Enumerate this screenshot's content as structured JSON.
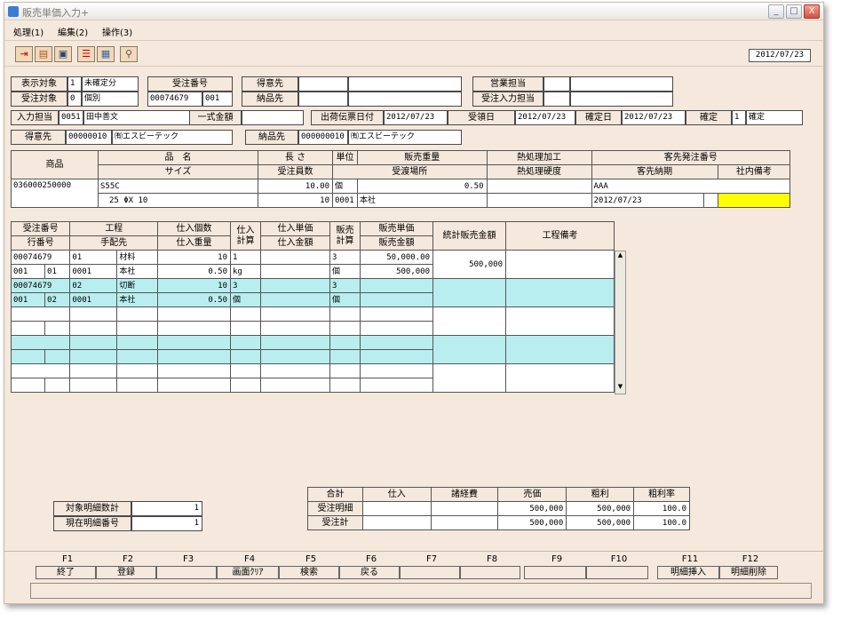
{
  "window": {
    "title": "販売単価入力+",
    "date": "2012/07/23",
    "min": "_",
    "max": "□",
    "close": "X"
  },
  "menu": [
    "処理(1)",
    "編集(2)",
    "操作(3)"
  ],
  "toolbar_icons": [
    "exit-icon",
    "book-icon",
    "computer-icon",
    "grid-icon",
    "calendar-icon",
    "magnify-icon"
  ],
  "header": {
    "hyoji_label": "表示対象",
    "hyoji_code": "1",
    "hyoji_value": "未確定分",
    "juchu_taisho_label": "受注対象",
    "juchu_taisho_code": "0",
    "juchu_taisho_value": "個別",
    "juchu_no_label": "受注番号",
    "juchu_no": "00074679",
    "juchu_no2": "001",
    "tokuisaki_label": "得意先",
    "nohinsaki_label": "納品先",
    "eigyo_label": "営業担当",
    "juchu_nyuryoku_label": "受注入力担当",
    "nyuryoku_label": "入力担当",
    "nyuryoku_code": "0051",
    "nyuryoku_name": "田中善文",
    "isshiki_label": "一式金額",
    "shukka_label": "出荷伝票日付",
    "shukka_date": "2012/07/23",
    "uketori_label": "受領日",
    "uketori_date": "2012/07/23",
    "kakutei_date_label": "確定日",
    "kakutei_date": "2012/07/23",
    "kakutei_label": "確定",
    "kakutei_code": "1",
    "kakutei_value": "確定",
    "tokui_label": "得意先",
    "tokui_code": "00000010",
    "tokui_name": "㈲エスビーテック",
    "nohin_label": "納品先",
    "nohin_code": "000000010",
    "nohin_name": "㈲エスビーテック"
  },
  "product": {
    "h_shohin": "商品",
    "h_hinmei": "品　名",
    "h_size": "サイズ",
    "h_nagasa": "長 さ",
    "h_juchu_kosu": "受注員数",
    "h_tani": "単位",
    "h_hanbai_juryo": "販売重量",
    "h_ukewatashi": "受渡場所",
    "h_netsu": "熱処理加工",
    "h_netsu_kodo": "熱処理硬度",
    "h_kyaku_no": "客先発注番号",
    "h_kyaku_noki": "客先納期",
    "h_shanai": "社内備考",
    "code": "036000250000",
    "hinmei": "S55C",
    "size": "25 ΦX  10",
    "nagasa": "10.00",
    "kosu": "10",
    "tani": "個",
    "juryo": "0.50",
    "basho_code": "0001",
    "basho": "本社",
    "kyaku_no": "AAA",
    "noki": "2012/07/23"
  },
  "detail_headers": {
    "juchu_no": "受注番号",
    "gyo_no": "行番号",
    "kotei": "工程",
    "tehaisaki": "手配先",
    "shiire_kosu": "仕入個数",
    "shiire_juryo": "仕入重量",
    "shiire_keisan": "仕入計算",
    "shiire_tanka": "仕入単価",
    "shiire_kingaku": "仕入金額",
    "hanbai_keisan": "販売計算",
    "hanbai_tanka": "販売単価",
    "hanbai_kingaku": "販売金額",
    "tokei": "統計販売金額",
    "biko": "工程備考"
  },
  "detail_rows": [
    {
      "a": "00074679",
      "b": "",
      "c": "01",
      "d": "材料",
      "e": "10",
      "f": "1",
      "g": "",
      "h": "3",
      "i": "50,000.00",
      "j": "500,000",
      "k": ""
    },
    {
      "a": "001",
      "b": "01",
      "c": "0001",
      "d": "本社",
      "e": "0.50",
      "f": "kg",
      "g": "",
      "h": "個",
      "i": "500,000",
      "j": "",
      "k": ""
    },
    {
      "a": "00074679",
      "b": "",
      "c": "02",
      "d": "切断",
      "e": "10",
      "f": "3",
      "g": "",
      "h": "3",
      "i": "",
      "j": "",
      "k": ""
    },
    {
      "a": "001",
      "b": "02",
      "c": "0001",
      "d": "本社",
      "e": "0.50",
      "f": "個",
      "g": "",
      "h": "個",
      "i": "",
      "j": "",
      "k": ""
    }
  ],
  "scroll": {
    "up": "▲",
    "down": "▼"
  },
  "counts": {
    "taisho_label": "対象明細数計",
    "taisho_value": "1",
    "genzai_label": "現在明細番号",
    "genzai_value": "1"
  },
  "summary": {
    "headers": [
      "合計",
      "仕入",
      "諸経費",
      "売価",
      "粗利",
      "粗利率"
    ],
    "rows": [
      {
        "label": "受注明細",
        "shiire": "",
        "shokeihi": "",
        "baika": "500,000",
        "arari": "500,000",
        "ritsu": "100.0"
      },
      {
        "label": "受注計",
        "shiire": "",
        "shokeihi": "",
        "baika": "500,000",
        "arari": "500,000",
        "ritsu": "100.0"
      }
    ]
  },
  "fkeys": [
    {
      "key": "F1",
      "label": "終了"
    },
    {
      "key": "F2",
      "label": "登録"
    },
    {
      "key": "F3",
      "label": ""
    },
    {
      "key": "F4",
      "label": "画面ｸﾘｱ"
    },
    {
      "key": "F5",
      "label": "検索"
    },
    {
      "key": "F6",
      "label": "戻る"
    },
    {
      "key": "F7",
      "label": ""
    },
    {
      "key": "F8",
      "label": ""
    },
    {
      "key": "F9",
      "label": ""
    },
    {
      "key": "F10",
      "label": ""
    },
    {
      "key": "F11",
      "label": "明細挿入"
    },
    {
      "key": "F12",
      "label": "明細削除"
    }
  ]
}
